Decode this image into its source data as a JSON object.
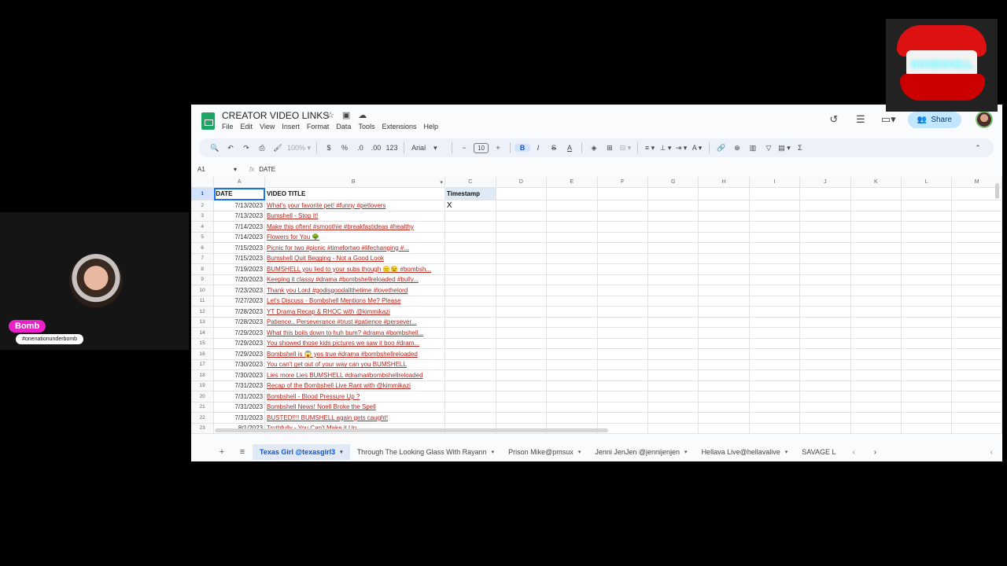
{
  "overlay": {
    "streamer_name": "Bomb",
    "streamer_tag": "#onenationunderbomb",
    "logo_text": "BOMBSHELL"
  },
  "app": {
    "doc_title": "CREATOR VIDEO LINKS",
    "menu": [
      "File",
      "Edit",
      "View",
      "Insert",
      "Format",
      "Data",
      "Tools",
      "Extensions",
      "Help"
    ],
    "share_label": "Share"
  },
  "toolbar": {
    "zoom": "100%",
    "currency": "$",
    "percent": "%",
    "dec_decrease": ".0",
    "dec_increase": ".00",
    "more_formats": "123",
    "font": "Arial",
    "font_size": "10"
  },
  "formula_bar": {
    "cell_ref": "A1",
    "content": "DATE"
  },
  "grid": {
    "columns": [
      "A",
      "B",
      "C",
      "D",
      "E",
      "F",
      "G",
      "H",
      "I",
      "J",
      "K",
      "L",
      "M"
    ],
    "header_row": {
      "row": "1",
      "date": "DATE",
      "title": "VIDEO TITLE",
      "timestamp": "Timestamp"
    },
    "rows": [
      {
        "row": "2",
        "date": "7/13/2023",
        "title": "What's your favorite pet! #funny #petlovers",
        "timestamp": "X"
      },
      {
        "row": "3",
        "date": "7/13/2023",
        "title": "Bumshell - Stop It!",
        "timestamp": ""
      },
      {
        "row": "4",
        "date": "7/14/2023",
        "title": "Make this often! #smoothie #breakfastideas #healthy",
        "timestamp": ""
      },
      {
        "row": "5",
        "date": "7/14/2023",
        "title": "Flowers for You 🌳",
        "timestamp": ""
      },
      {
        "row": "6",
        "date": "7/15/2023",
        "title": "Picnic for two #picnic #timefortwo #lifechanging #...",
        "timestamp": ""
      },
      {
        "row": "7",
        "date": "7/15/2023",
        "title": "Bumshell Quit Begging - Not a Good Look",
        "timestamp": ""
      },
      {
        "row": "8",
        "date": "7/19/2023",
        "title": "BUMSHELL you lied to your subs though 😑😉 #bombsh...",
        "timestamp": ""
      },
      {
        "row": "9",
        "date": "7/20/2023",
        "title": "Keeping it classy #drama #bombshellreloaded #bully...",
        "timestamp": ""
      },
      {
        "row": "10",
        "date": "7/23/2023",
        "title": "Thank you Lord #godisgoodallthetime #lovethelord",
        "timestamp": ""
      },
      {
        "row": "11",
        "date": "7/27/2023",
        "title": "Let's Discuss - Bombshell Mentions Me? Please",
        "timestamp": ""
      },
      {
        "row": "12",
        "date": "7/28/2023",
        "title": "YT Drama Recap & RHOC with @kimmikazi",
        "timestamp": ""
      },
      {
        "row": "13",
        "date": "7/28/2023",
        "title": "Patience.. Perseverance #trust #patience #persever...",
        "timestamp": ""
      },
      {
        "row": "14",
        "date": "7/29/2023",
        "title": "What this boils down to huh bum? #drama #bombshell...",
        "timestamp": ""
      },
      {
        "row": "15",
        "date": "7/29/2023",
        "title": "You showed those kids pictures we saw it boo #dram...",
        "timestamp": ""
      },
      {
        "row": "16",
        "date": "7/29/2023",
        "title": "Bombshell is 😱 yes true #drama #bombshellreloaded",
        "timestamp": ""
      },
      {
        "row": "17",
        "date": "7/30/2023",
        "title": "You can't get out of your way can you BUMSHELL",
        "timestamp": ""
      },
      {
        "row": "18",
        "date": "7/30/2023",
        "title": "Lies more Lies BUMSHELL #drama#bombshellreloaded",
        "timestamp": ""
      },
      {
        "row": "19",
        "date": "7/31/2023",
        "title": "Recap of the Bombshell Live Rant with @kimmikazi",
        "timestamp": ""
      },
      {
        "row": "20",
        "date": "7/31/2023",
        "title": "Bombshell - Blood Pressure Up ?",
        "timestamp": ""
      },
      {
        "row": "21",
        "date": "7/31/2023",
        "title": "Bombshell News! Noell Broke the Spell",
        "timestamp": ""
      },
      {
        "row": "22",
        "date": "7/31/2023",
        "title": "BUSTED!!!! BUMSHELL again gets caught!",
        "timestamp": ""
      },
      {
        "row": "23",
        "date": "8/1/2023",
        "title": "Truthfully - You Can't Make it Up",
        "timestamp": ""
      }
    ]
  },
  "sheet_tabs": [
    {
      "label": "Texas Girl @texasgirl3",
      "active": true
    },
    {
      "label": "Through The Looking Glass With Rayann",
      "active": false
    },
    {
      "label": "Prison Mike@pmsux",
      "active": false
    },
    {
      "label": "Jenni JenJen @jennijenjen",
      "active": false
    },
    {
      "label": "Hellava Live@hellavalive",
      "active": false
    },
    {
      "label": "SAVAGE L",
      "active": false
    }
  ]
}
